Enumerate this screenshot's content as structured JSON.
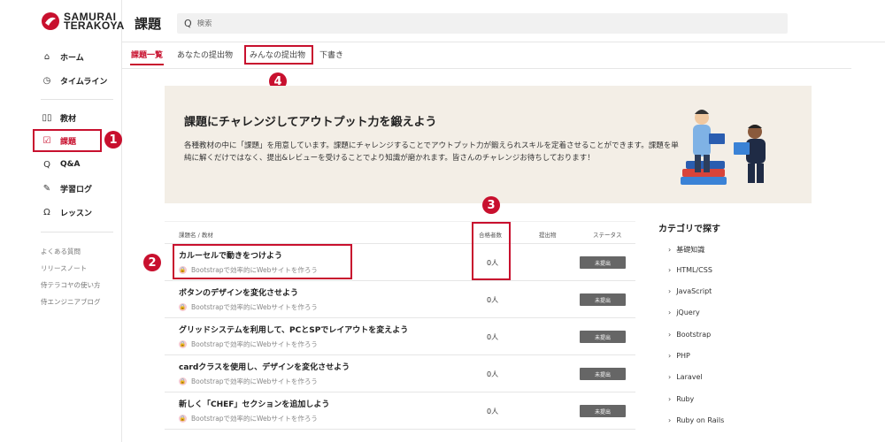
{
  "brand": {
    "line1": "SAMURAI",
    "line2": "TERAKOYA",
    "color": "#c8102e"
  },
  "sidebar": {
    "items": [
      {
        "label": "ホーム",
        "icon": "home-icon",
        "active": false
      },
      {
        "label": "タイムライン",
        "icon": "clock-icon",
        "active": false
      },
      {
        "label": "教材",
        "icon": "book-icon",
        "active": false
      },
      {
        "label": "課題",
        "icon": "assignment-icon",
        "active": true
      },
      {
        "label": "Q&A",
        "icon": "search-icon",
        "active": false
      },
      {
        "label": "学習ログ",
        "icon": "pencil-icon",
        "active": false
      },
      {
        "label": "レッスン",
        "icon": "headset-icon",
        "active": false
      }
    ],
    "links": [
      "よくある質問",
      "リリースノート",
      "侍テラコヤの使い方",
      "侍エンジニアブログ"
    ]
  },
  "header": {
    "title": "課題",
    "search_placeholder": "検索"
  },
  "tabs": [
    {
      "label": "課題一覧",
      "active": true
    },
    {
      "label": "あなたの提出物",
      "active": false
    },
    {
      "label": "みんなの提出物",
      "active": false
    },
    {
      "label": "下書き",
      "active": false
    }
  ],
  "banner": {
    "title": "課題にチャレンジしてアウトプット力を鍛えよう",
    "text": "各種教材の中に「課題」を用意しています。課題にチャレンジすることでアウトプット力が鍛えられスキルを定着させることができます。課題を単純に解くだけではなく、提出&レビューを受けることでより知識が磨かれます。皆さんのチャレンジお待ちしております！"
  },
  "table": {
    "headers": {
      "name": "課題名 / 教材",
      "passed": "合格者数",
      "submissions": "提出物",
      "status": "ステータス"
    },
    "rows": [
      {
        "title": "カルーセルで動きをつけよう",
        "material": "Bootstrapで効率的にWebサイトを作ろう",
        "passed": "0人",
        "status": "未提出"
      },
      {
        "title": "ボタンのデザインを変化させよう",
        "material": "Bootstrapで効率的にWebサイトを作ろう",
        "passed": "0人",
        "status": "未提出"
      },
      {
        "title": "グリッドシステムを利用して、PCとSPでレイアウトを変えよう",
        "material": "Bootstrapで効率的にWebサイトを作ろう",
        "passed": "0人",
        "status": "未提出"
      },
      {
        "title": "cardクラスを使用し、デザインを変化させよう",
        "material": "Bootstrapで効率的にWebサイトを作ろう",
        "passed": "0人",
        "status": "未提出"
      },
      {
        "title": "新しく「CHEF」セクションを追加しよう",
        "material": "Bootstrapで効率的にWebサイトを作ろう",
        "passed": "0人",
        "status": "未提出"
      }
    ]
  },
  "categories": {
    "title": "カテゴリで探す",
    "items": [
      "基礎知識",
      "HTML/CSS",
      "JavaScript",
      "jQuery",
      "Bootstrap",
      "PHP",
      "Laravel",
      "Ruby",
      "Ruby on Rails"
    ]
  },
  "annotations": {
    "m1": "1",
    "m2": "2",
    "m3": "3",
    "m4": "4",
    "color": "#c8102e"
  }
}
